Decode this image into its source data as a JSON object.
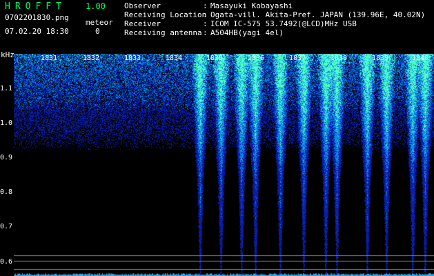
{
  "app": {
    "title": "HROFFT",
    "version": "1.00"
  },
  "file": {
    "name": "0702201830.png",
    "datetime": "07.02.20 18:30"
  },
  "meteor": {
    "label": "meteor",
    "count": "0"
  },
  "info": [
    {
      "label": "Observer",
      "value": "Masayuki Kobayashi"
    },
    {
      "label": "Receiving Location",
      "value": "Ogata-vill. Akita-Pref. JAPAN (139.96E, 40.02N)"
    },
    {
      "label": "Receiver",
      "value": "ICOM IC-575 53.7492(@LCD)MHz USB"
    },
    {
      "label": "Receiving antenna",
      "value": "A504HB(yagi 4el)"
    }
  ],
  "spectrogram": {
    "y_unit": "kHz",
    "y_ticks": [
      "1.1",
      "1.0",
      "0.9",
      "0.8",
      "0.7",
      "0.6"
    ],
    "x_ticks": [
      "1831",
      "1832",
      "1833",
      "1834",
      "1835",
      "1836",
      "1837",
      "1838",
      "1839",
      "1840"
    ],
    "colors": {
      "background": "#000000",
      "noise": "#0a1a9a",
      "signal": "#33ffcc",
      "peak": "#ffff66",
      "reference_line": "#888888"
    }
  }
}
